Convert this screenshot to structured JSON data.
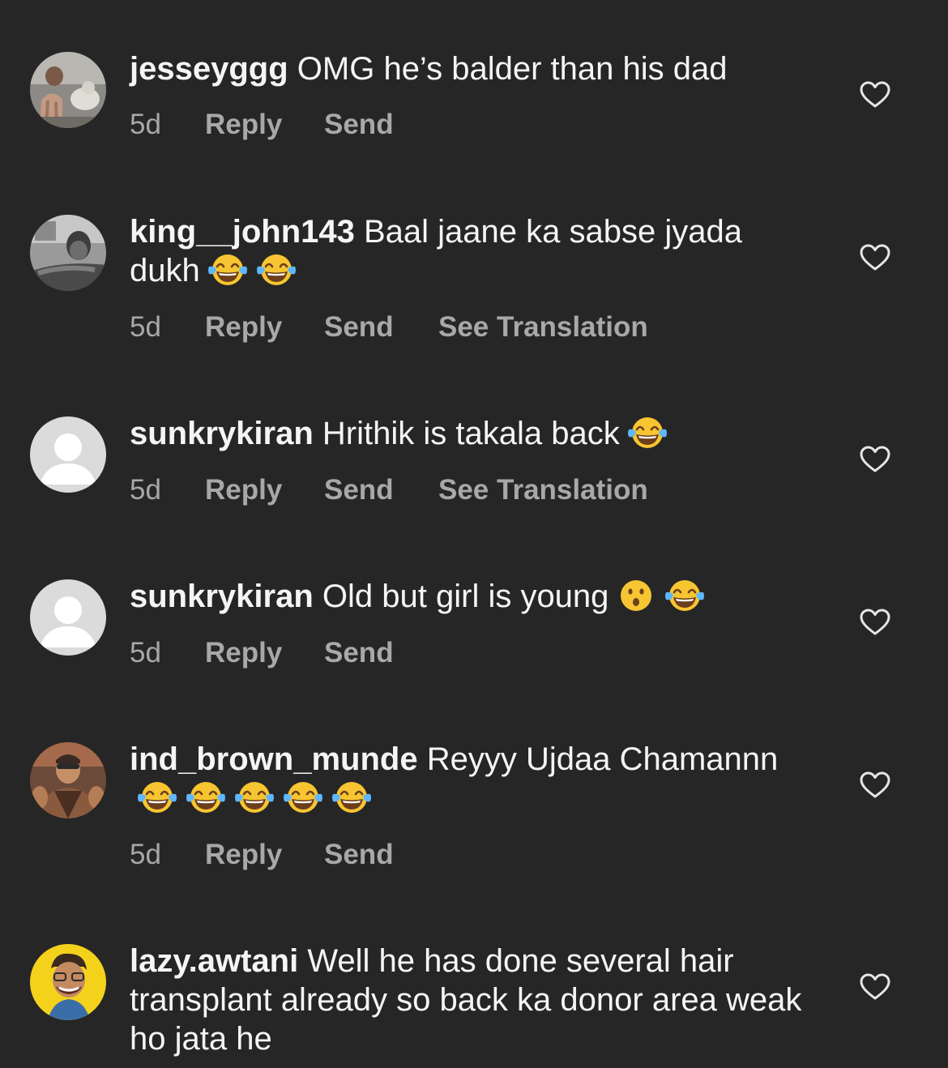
{
  "colors": {
    "background": "#262626",
    "text": "#f5f5f5",
    "meta": "#a8a8a8"
  },
  "comments": [
    {
      "username": "jesseyggg",
      "text": "OMG he’s balder than his dad",
      "time": "5d",
      "reply": "Reply",
      "send": "Send"
    },
    {
      "username": "king__john143",
      "text": "Baal jaane ka sabse jyada dukh",
      "emojis": [
        "face-with-tears-of-joy",
        "face-with-tears-of-joy"
      ],
      "time": "5d",
      "reply": "Reply",
      "send": "Send",
      "translation": "See Translation"
    },
    {
      "username": "sunkrykiran",
      "text": "Hrithik is takala back",
      "emojis": [
        "face-with-tears-of-joy"
      ],
      "time": "5d",
      "reply": "Reply",
      "send": "Send",
      "translation": "See Translation"
    },
    {
      "username": "sunkrykiran",
      "text": "Old but girl is young",
      "emojis": [
        "astonished-face",
        "face-with-tears-of-joy"
      ],
      "time": "5d",
      "reply": "Reply",
      "send": "Send"
    },
    {
      "username": "ind_brown_munde",
      "text": "Reyyy Ujdaa Chamannn",
      "emojis": [
        "face-with-tears-of-joy",
        "face-with-tears-of-joy",
        "face-with-tears-of-joy",
        "face-with-tears-of-joy",
        "face-with-tears-of-joy"
      ],
      "time": "5d",
      "reply": "Reply",
      "send": "Send"
    },
    {
      "username": "lazy.awtani",
      "text": "Well he has done several hair transplant already so back ka donor area weak ho jata he"
    }
  ]
}
